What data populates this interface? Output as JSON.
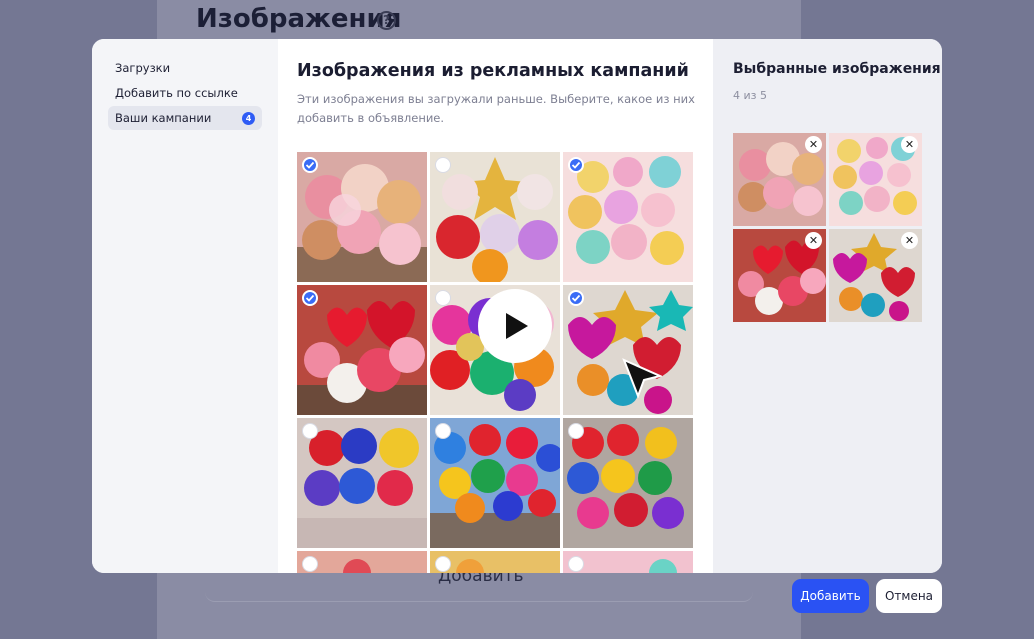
{
  "background": {
    "title": "Изображения",
    "help_icon": "?",
    "add_label": "Добавить"
  },
  "sidebar": {
    "items": [
      {
        "label": "Загрузки"
      },
      {
        "label": "Добавить по ссылке"
      },
      {
        "label": "Ваши кампании",
        "badge": "4"
      }
    ]
  },
  "main": {
    "title": "Изображения из рекламных кампаний",
    "description": "Эти изображения вы загружали раньше. Выберите, какое из них добавить в объявление.",
    "play_icon": "play-icon",
    "grid": [
      {
        "checked": true
      },
      {
        "checked": false
      },
      {
        "checked": true
      },
      {
        "checked": true
      },
      {
        "checked": false
      },
      {
        "checked": true
      },
      {
        "checked": false
      },
      {
        "checked": false
      },
      {
        "checked": false
      },
      {
        "checked": false
      },
      {
        "checked": false
      },
      {
        "checked": false
      }
    ]
  },
  "selected": {
    "title": "Выбранные изображения",
    "count": "4 из 5",
    "close_glyph": "✕"
  },
  "footer": {
    "add_button": "Добавить",
    "cancel_button": "Отмена"
  },
  "colors": {
    "accent": "#2a52f3",
    "overlay": "#747793"
  }
}
